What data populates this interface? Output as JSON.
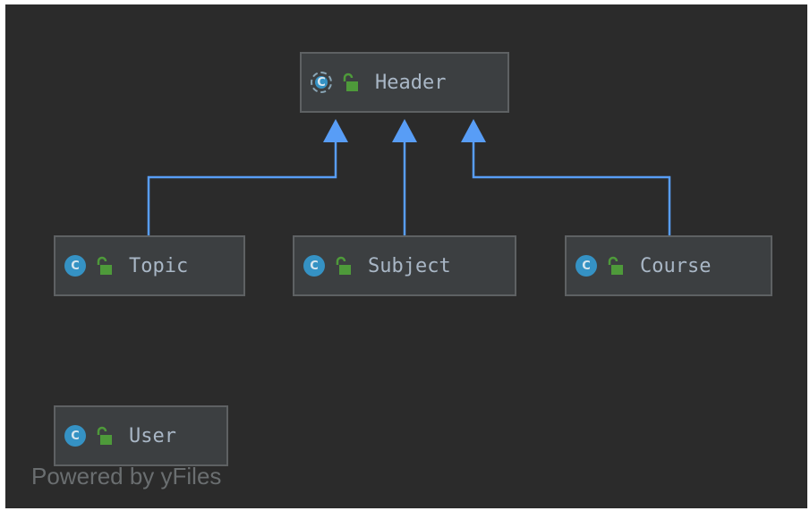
{
  "diagram": {
    "nodes": [
      {
        "id": "header",
        "label": "Header",
        "icon": "abstract-class-icon",
        "visibility": "public"
      },
      {
        "id": "topic",
        "label": "Topic",
        "icon": "class-icon",
        "visibility": "public"
      },
      {
        "id": "subject",
        "label": "Subject",
        "icon": "class-icon",
        "visibility": "public"
      },
      {
        "id": "course",
        "label": "Course",
        "icon": "class-icon",
        "visibility": "public"
      },
      {
        "id": "user",
        "label": "User",
        "icon": "class-icon",
        "visibility": "public"
      }
    ],
    "edges": [
      {
        "from": "topic",
        "to": "header",
        "type": "inheritance"
      },
      {
        "from": "subject",
        "to": "header",
        "type": "inheritance"
      },
      {
        "from": "course",
        "to": "header",
        "type": "inheritance"
      }
    ],
    "icon_letter": "C",
    "watermark": "Powered by yFiles",
    "colors": {
      "background": "#2b2b2b",
      "node_fill": "#3c3f41",
      "node_border": "#5e6163",
      "edge": "#589df6",
      "class_icon": "#3592c4",
      "lock_icon": "#4e9a3a",
      "label": "#a9b7c6"
    }
  }
}
